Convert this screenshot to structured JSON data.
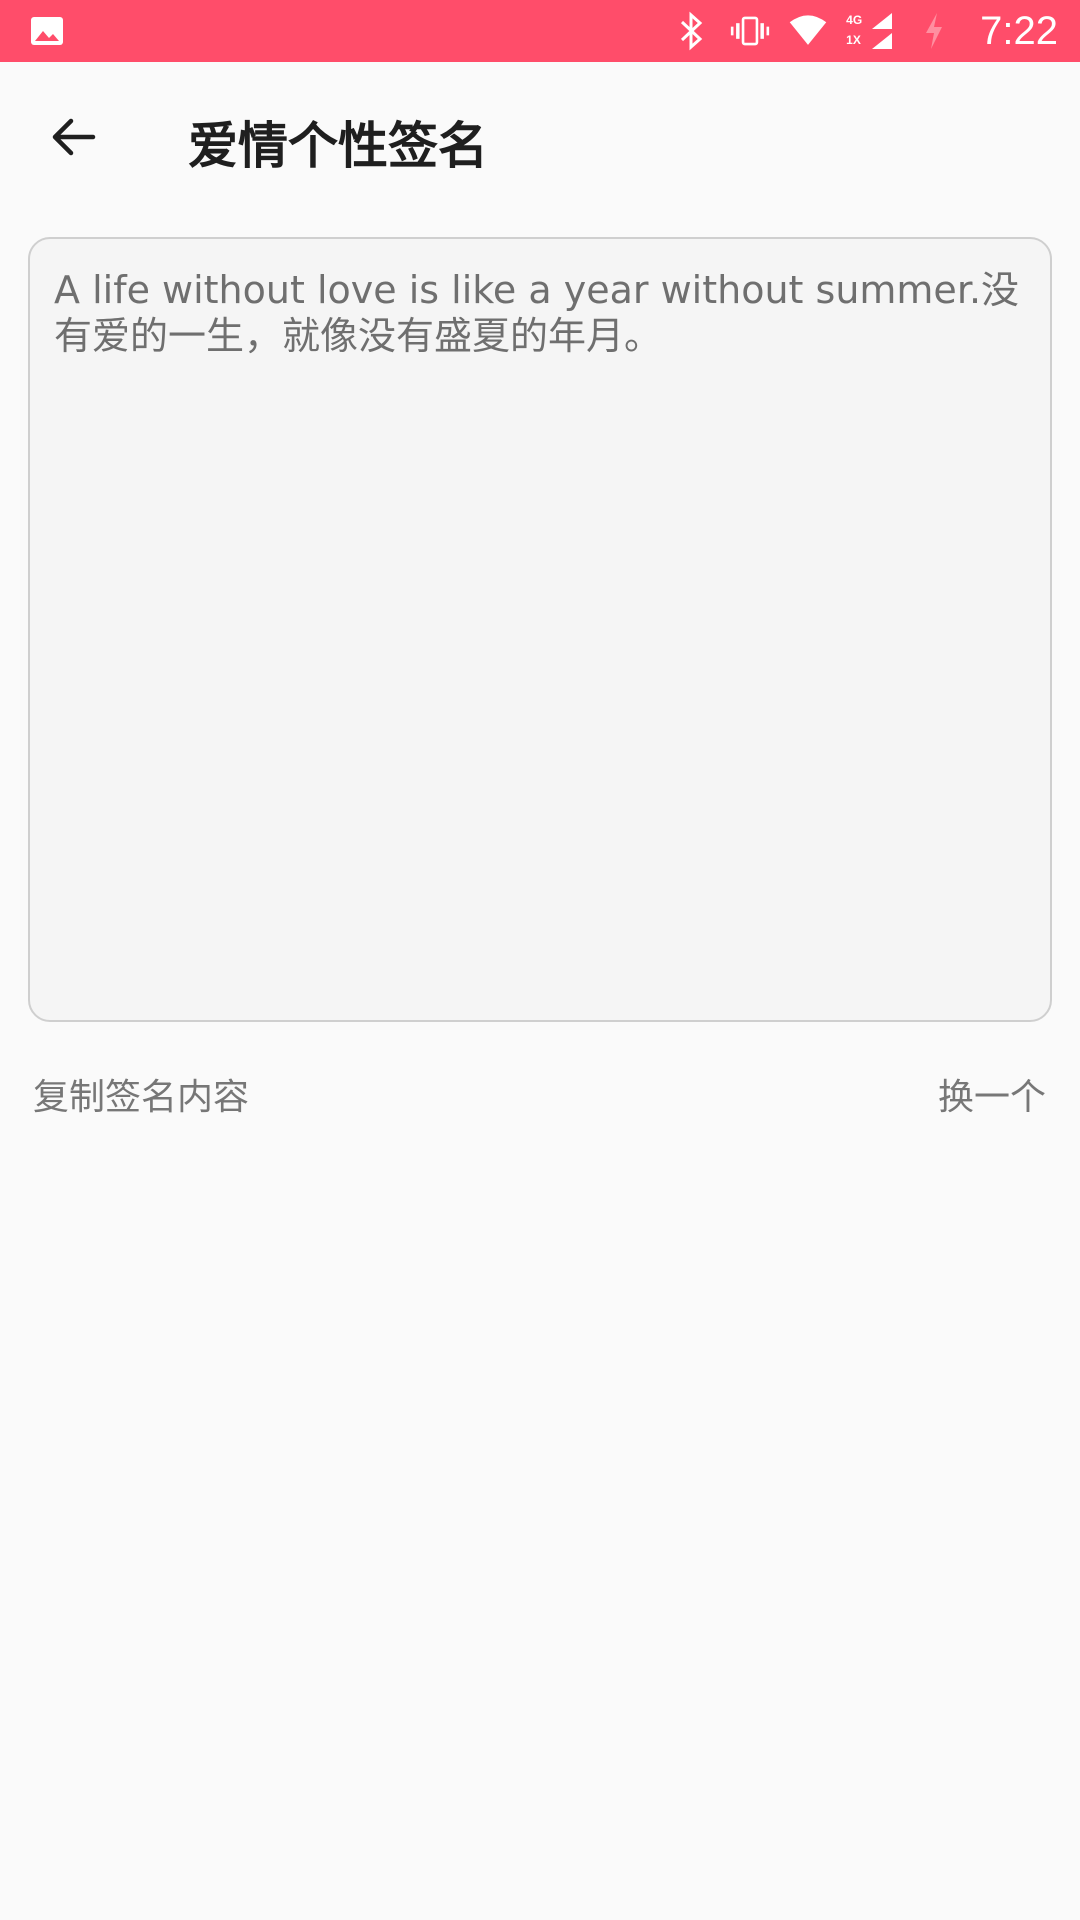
{
  "status_bar": {
    "time": "7:22",
    "network_label_top": "4G",
    "network_label_bottom": "1X",
    "bg_color": "#ff4d6a",
    "icons": [
      "image-icon",
      "bluetooth-icon",
      "vibrate-icon",
      "wifi-icon",
      "signal-icon",
      "charging-icon"
    ]
  },
  "header": {
    "title": "爱情个性签名",
    "back_icon": "arrow-left-icon"
  },
  "signature": {
    "text": "A life without love is like a year without summer.没有爱的一生，就像没有盛夏的年月。"
  },
  "actions": {
    "copy_label": "复制签名内容",
    "next_label": "换一个"
  }
}
